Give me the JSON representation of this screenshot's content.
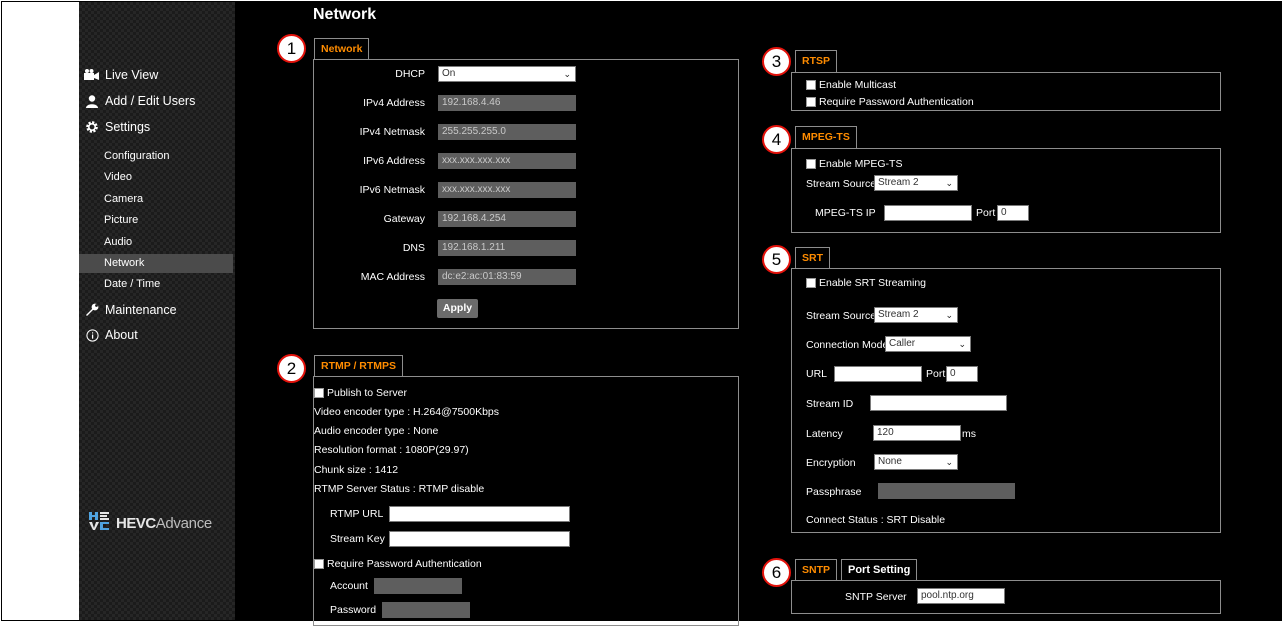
{
  "page": {
    "title": "Network"
  },
  "sidebar": {
    "main_items": [
      {
        "label": "Live View",
        "icon": "video-camera-icon"
      },
      {
        "label": "Add / Edit Users",
        "icon": "user-icon"
      },
      {
        "label": "Settings",
        "icon": "gear-icon"
      },
      {
        "label": "Maintenance",
        "icon": "wrench-icon"
      },
      {
        "label": "About",
        "icon": "info-icon"
      }
    ],
    "sub_items": [
      "Configuration",
      "Video",
      "Camera",
      "Picture",
      "Audio",
      "Network",
      "Date / Time"
    ],
    "active_sub": "Network",
    "logo": {
      "brand": "HEVC",
      "suffix": "Advance",
      "mark": "HE VC"
    }
  },
  "callouts": [
    "1",
    "2",
    "3",
    "4",
    "5",
    "6"
  ],
  "network": {
    "tab": "Network",
    "dhcp_label": "DHCP",
    "dhcp_value": "On",
    "ipv4_label": "IPv4 Address",
    "ipv4_value": "192.168.4.46",
    "netmask_label": "IPv4 Netmask",
    "netmask_value": "255.255.255.0",
    "ipv6_label": "IPv6 Address",
    "ipv6_value": "xxx.xxx.xxx.xxx",
    "ipv6mask_label": "IPv6 Netmask",
    "ipv6mask_value": "xxx.xxx.xxx.xxx",
    "gateway_label": "Gateway",
    "gateway_value": "192.168.4.254",
    "dns_label": "DNS",
    "dns_value": "192.168.1.211",
    "mac_label": "MAC Address",
    "mac_value": "dc:e2:ac:01:83:59",
    "apply": "Apply"
  },
  "rtmp": {
    "tab": "RTMP / RTMPS",
    "publish": "Publish to Server",
    "video_encoder": "Video encoder type : H.264@7500Kbps",
    "audio_encoder": "Audio encoder type : None",
    "resolution": "Resolution format : 1080P(29.97)",
    "chunk": "Chunk size : 1412",
    "status": "RTMP Server Status : RTMP disable",
    "url_label": "RTMP URL",
    "key_label": "Stream Key",
    "require_pw": "Require Password Authentication",
    "account_label": "Account",
    "password_label": "Password"
  },
  "rtsp": {
    "tab": "RTSP",
    "multicast": "Enable Multicast",
    "require_pw": "Require Password Authentication"
  },
  "mpegts": {
    "tab": "MPEG-TS",
    "enable": "Enable MPEG-TS",
    "source_label": "Stream Source",
    "source_value": "Stream 2",
    "ip_label": "MPEG-TS IP",
    "port_label": "Port",
    "port_value": "0"
  },
  "srt": {
    "tab": "SRT",
    "enable": "Enable SRT Streaming",
    "source_label": "Stream Source",
    "source_value": "Stream 2",
    "mode_label": "Connection Mode",
    "mode_value": "Caller",
    "url_label": "URL",
    "port_label": "Port",
    "port_value": "0",
    "streamid_label": "Stream ID",
    "latency_label": "Latency",
    "latency_value": "120",
    "latency_unit": "ms",
    "encryption_label": "Encryption",
    "encryption_value": "None",
    "passphrase_label": "Passphrase",
    "status": "Connect Status : SRT Disable"
  },
  "sntp": {
    "tab": "SNTP",
    "tab2": "Port Setting",
    "server_label": "SNTP Server",
    "server_value": "pool.ntp.org"
  },
  "colors": {
    "accent": "#ff8c00",
    "callout_ring": "#e3120b",
    "active_nav": "#4b4b4b",
    "background": "#000000"
  }
}
